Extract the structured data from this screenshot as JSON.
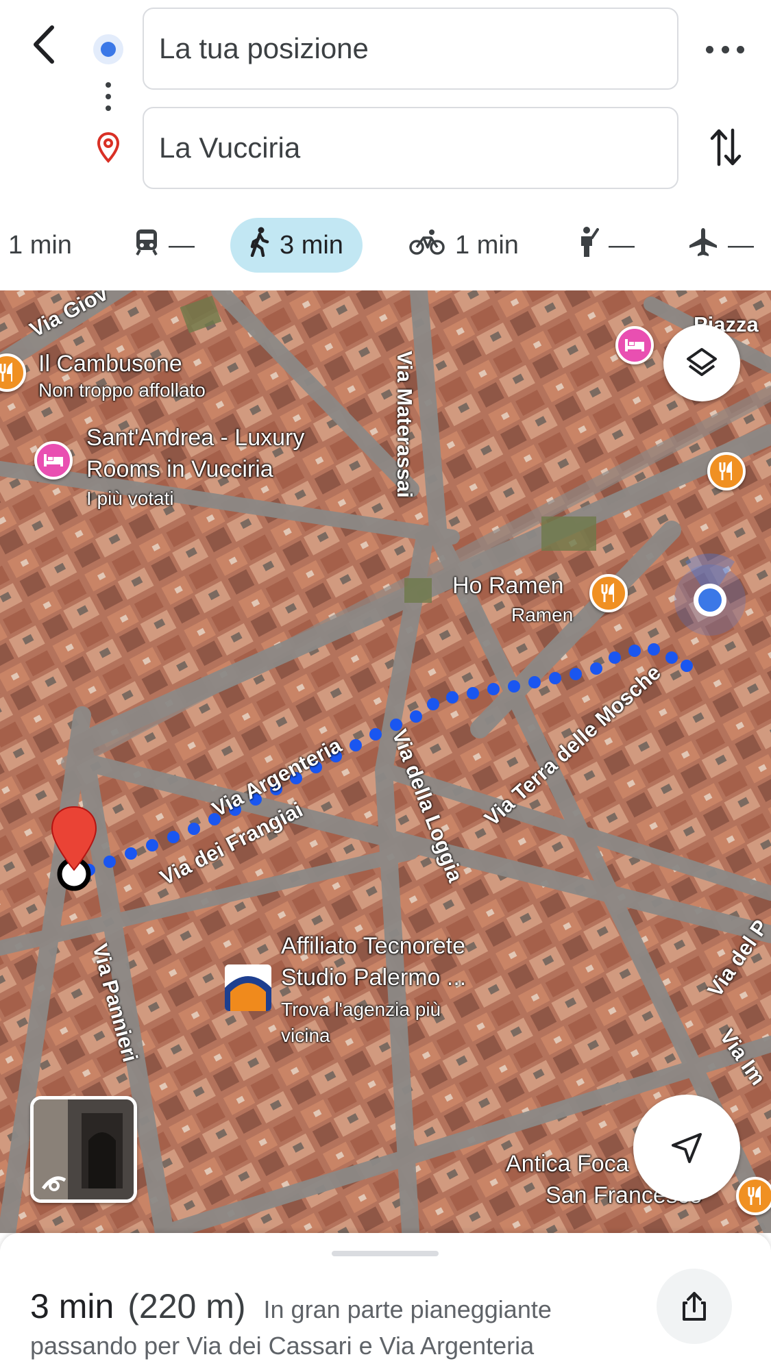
{
  "directions": {
    "origin_value": "La tua posizione",
    "destination_value": "La Vucciria"
  },
  "modes": [
    {
      "name": "drive",
      "label": "1 min",
      "icon": "car-icon"
    },
    {
      "name": "transit",
      "label": "—",
      "icon": "train-icon"
    },
    {
      "name": "walk",
      "label": "3 min",
      "icon": "walk-icon",
      "active": true
    },
    {
      "name": "bike",
      "label": "1 min",
      "icon": "bike-icon"
    },
    {
      "name": "ride",
      "label": "—",
      "icon": "hail-icon"
    },
    {
      "name": "flight",
      "label": "—",
      "icon": "plane-icon"
    }
  ],
  "map": {
    "streets": {
      "via_giov": "Via Giov",
      "piazza": "Piazza",
      "materassai": "Via Materassai",
      "argenteria": "Via Argenteria",
      "frangiai": "Via dei Frangiai",
      "loggia": "Via della Loggia",
      "terra_mosche": "Via Terra delle Mosche",
      "pannieri": "Via Pannieri",
      "via_del_p": "Via del P",
      "via_im": "Via Im"
    },
    "places": {
      "cambusone_name": "Il Cambusone",
      "cambusone_sub": "Non troppo affollato",
      "santandrea_name_1": "Sant'Andrea - Luxury",
      "santandrea_name_2": "Rooms in Vucciria",
      "santandrea_sub": "I più votati",
      "horamen_name": "Ho Ramen",
      "horamen_sub": "Ramen",
      "tecnorete_name_1": "Affiliato Tecnorete",
      "tecnorete_name_2": "Studio Palermo ...",
      "tecnorete_sub_1": "Trova l'agenzia più",
      "tecnorete_sub_2": "vicina",
      "antica_name_1": "Antica Foca",
      "antica_name_2": "San Francesco"
    },
    "colors": {
      "route": "#1a56f0",
      "accent_blue": "#3b78e7",
      "pin_red": "#ea4335",
      "food_orange": "#f09022",
      "hotel_pink": "#e94fb1",
      "active_mode_bg": "#c2e7f3"
    }
  },
  "summary": {
    "time": "3 min",
    "distance": "(220 m)",
    "terrain": "In gran parte pianeggiante",
    "via": "passando per Via dei Cassari e Via Argenteria"
  }
}
